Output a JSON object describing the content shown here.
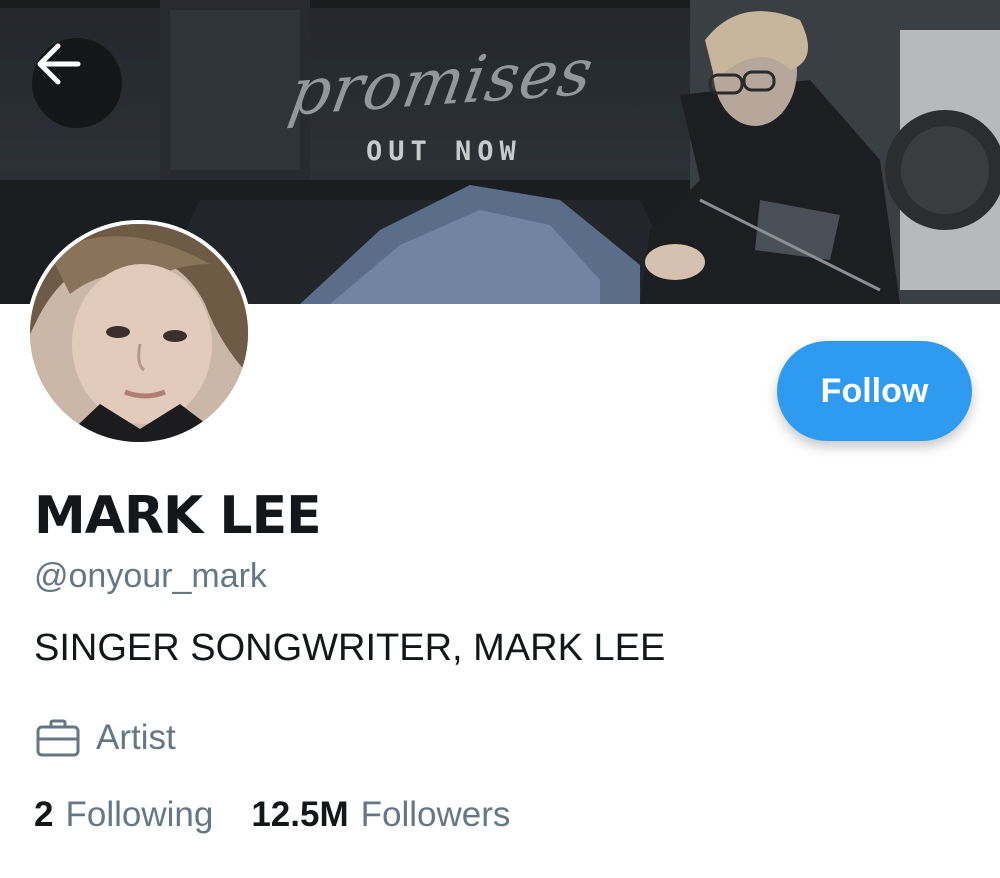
{
  "banner": {
    "script_text": "promises",
    "sub_text": "OUT NOW"
  },
  "header": {
    "back_icon": "arrow-left-icon"
  },
  "profile": {
    "display_name": "MARK LEE",
    "handle": "@onyour_mark",
    "bio": "SINGER SONGWRITER, MARK LEE",
    "category": {
      "icon": "briefcase-icon",
      "label": "Artist"
    },
    "stats": {
      "following_count": "2",
      "following_label": "Following",
      "followers_count": "12.5M",
      "followers_label": "Followers"
    }
  },
  "actions": {
    "follow_label": "Follow"
  },
  "colors": {
    "accent": "#2f9bf0",
    "text_primary": "#14171a",
    "text_secondary": "#657786"
  }
}
